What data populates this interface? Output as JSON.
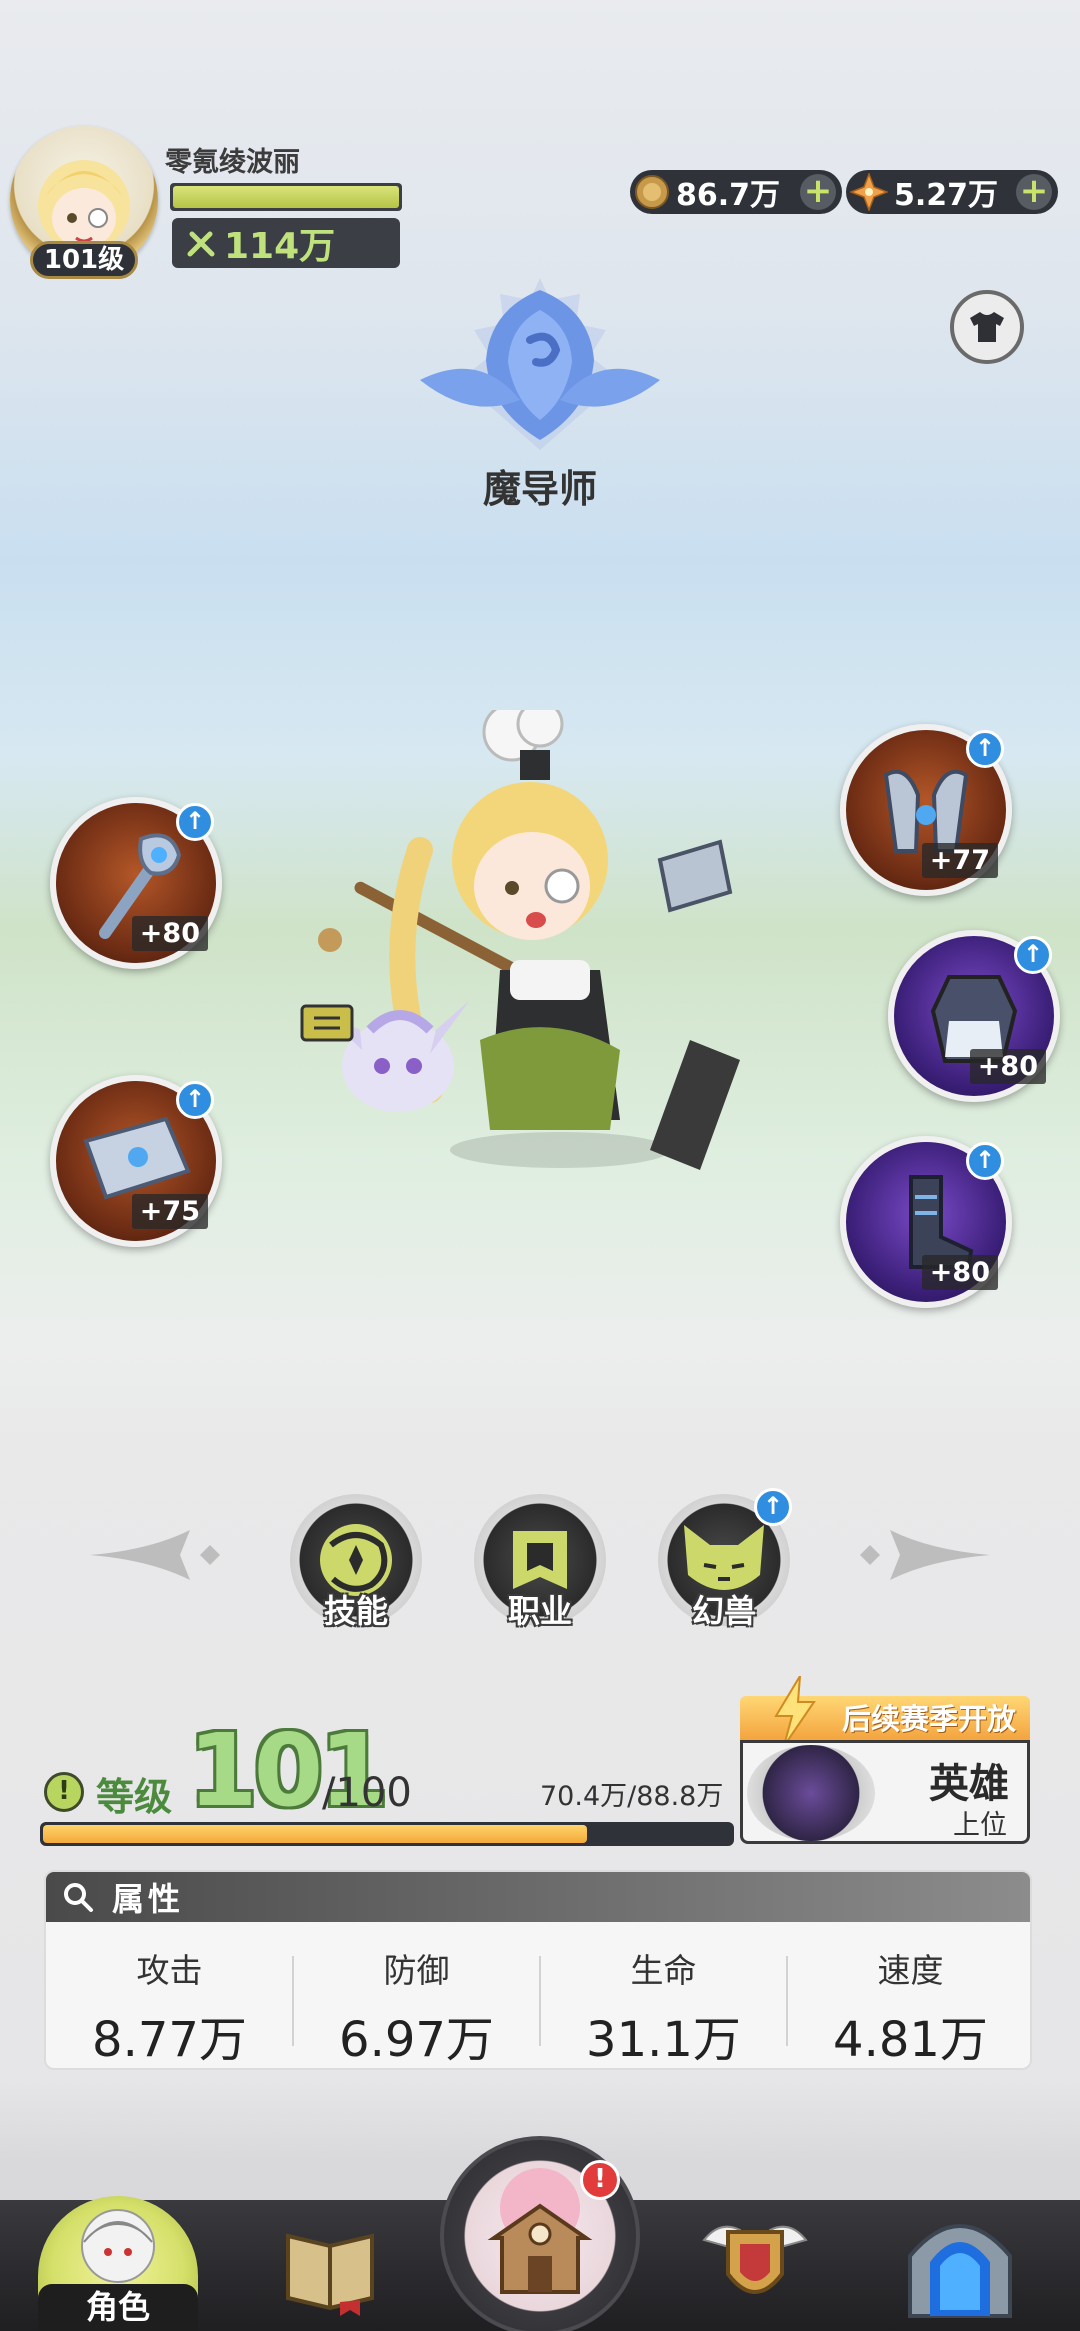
{
  "player": {
    "name": "零氪绫波丽",
    "level_badge": "101级",
    "combat_power": "114万"
  },
  "currencies": [
    {
      "icon": "gold-coin-icon",
      "value": "86.7万"
    },
    {
      "icon": "crystal-star-icon",
      "value": "5.27万"
    }
  ],
  "class": {
    "title": "魔导师"
  },
  "equipment": [
    {
      "slot": "weapon",
      "icon": "staff-icon",
      "enhance": "+80",
      "upgradable": true
    },
    {
      "slot": "book",
      "icon": "spellbook-icon",
      "enhance": "+75",
      "upgradable": true
    },
    {
      "slot": "helmet",
      "icon": "helmet-icon",
      "enhance": "+77",
      "upgradable": true
    },
    {
      "slot": "armor",
      "icon": "armor-icon",
      "enhance": "+80",
      "upgradable": true
    },
    {
      "slot": "boots",
      "icon": "boots-icon",
      "enhance": "+80",
      "upgradable": true
    }
  ],
  "features": [
    {
      "label": "技能",
      "icon": "skill-icon"
    },
    {
      "label": "职业",
      "icon": "class-icon"
    },
    {
      "label": "幻兽",
      "icon": "beast-icon"
    }
  ],
  "level": {
    "label": "等级",
    "current": "101",
    "max": "/100",
    "exp_text": "70.4万/88.8万",
    "exp_progress": 0.79
  },
  "hero_rank": {
    "banner": "后续赛季开放",
    "name": "英雄",
    "sub": "上位"
  },
  "attributes": {
    "title": "属性",
    "items": [
      {
        "label": "攻击",
        "value": "8.77万"
      },
      {
        "label": "防御",
        "value": "6.97万"
      },
      {
        "label": "生命",
        "value": "31.1万"
      },
      {
        "label": "速度",
        "value": "4.81万"
      }
    ]
  },
  "bottom_nav": {
    "role_label": "角色",
    "alert": "!"
  },
  "colors": {
    "accent_green": "#a7da86",
    "exp_bar": "#f3a93a",
    "upgrade_blue": "#2f8ee0",
    "alert_red": "#e23b3b"
  }
}
